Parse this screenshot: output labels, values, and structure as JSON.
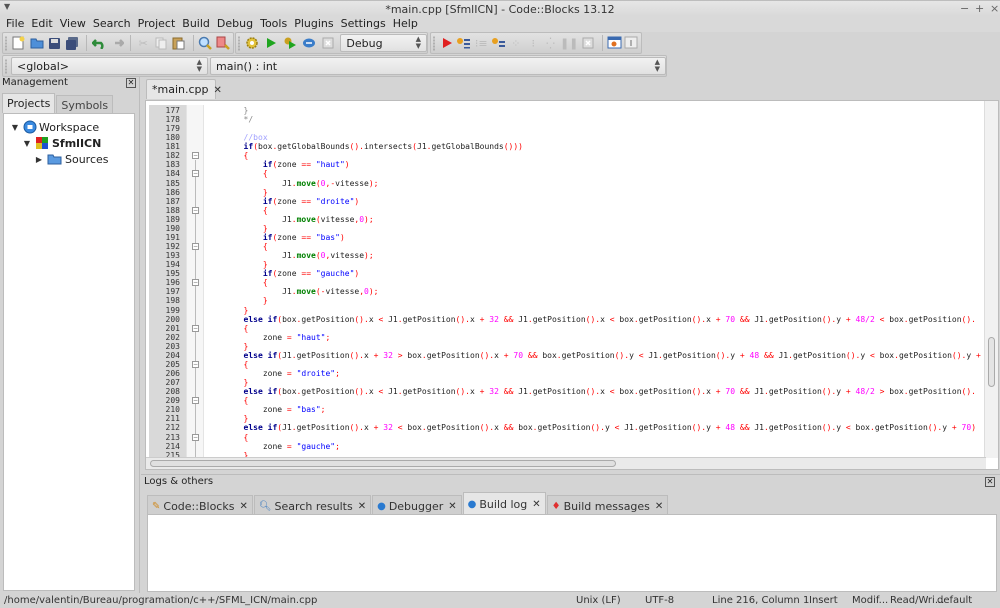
{
  "window": {
    "title": "*main.cpp [SfmlICN] - Code::Blocks 13.12",
    "controls": [
      "−",
      "+",
      "×"
    ]
  },
  "menubar": [
    "File",
    "Edit",
    "View",
    "Search",
    "Project",
    "Build",
    "Debug",
    "Tools",
    "Plugins",
    "Settings",
    "Help"
  ],
  "toolbar": {
    "build_target": "Debug",
    "scope_combo": "<global>",
    "function_combo": "main() : int"
  },
  "management": {
    "title": "Management",
    "tabs": [
      "Projects",
      "Symbols"
    ],
    "active_tab": "Projects",
    "tree": {
      "workspace": "Workspace",
      "project": "SfmlICN",
      "folder": "Sources"
    }
  },
  "editor": {
    "tab_label": "*main.cpp",
    "lines": [
      {
        "n": "177",
        "html": "<span class=\"cm2\">}</span>",
        "indent": 8
      },
      {
        "n": "178",
        "html": "<span class=\"cm2\">*/</span>",
        "indent": 8
      },
      {
        "n": "179",
        "html": "",
        "indent": 8
      },
      {
        "n": "180",
        "html": "<span class=\"cmt\">//box</span>",
        "indent": 8
      },
      {
        "n": "181",
        "html": "<span class=\"kw\">if</span><span class=\"op\">(</span>box<span class=\"op\">.</span>getGlobalBounds<span class=\"op\">().</span>intersects<span class=\"op\">(</span>J1<span class=\"op\">.</span>getGlobalBounds<span class=\"op\">()))</span>",
        "indent": 8
      },
      {
        "n": "182",
        "html": "<span class=\"op\">{</span>",
        "indent": 8
      },
      {
        "n": "183",
        "html": "<span class=\"kw\">if</span><span class=\"op\">(</span>zone <span class=\"op\">==</span> <span class=\"str\">\"haut\"</span><span class=\"op\">)</span>",
        "indent": 12
      },
      {
        "n": "184",
        "html": "<span class=\"op\">{</span>",
        "indent": 12
      },
      {
        "n": "185",
        "html": "J1<span class=\"op\">.</span><span class=\"fn\">move</span><span class=\"op\">(</span><span class=\"num\">0</span><span class=\"op\">,-</span>vitesse<span class=\"op\">);</span>",
        "indent": 16
      },
      {
        "n": "186",
        "html": "<span class=\"op\">}</span>",
        "indent": 12
      },
      {
        "n": "187",
        "html": "<span class=\"kw\">if</span><span class=\"op\">(</span>zone <span class=\"op\">==</span> <span class=\"str\">\"droite\"</span><span class=\"op\">)</span>",
        "indent": 12
      },
      {
        "n": "188",
        "html": "<span class=\"op\">{</span>",
        "indent": 12
      },
      {
        "n": "189",
        "html": "J1<span class=\"op\">.</span><span class=\"fn\">move</span><span class=\"op\">(</span>vitesse<span class=\"op\">,</span><span class=\"num\">0</span><span class=\"op\">);</span>",
        "indent": 16
      },
      {
        "n": "190",
        "html": "<span class=\"op\">}</span>",
        "indent": 12
      },
      {
        "n": "191",
        "html": "<span class=\"kw\">if</span><span class=\"op\">(</span>zone <span class=\"op\">==</span> <span class=\"str\">\"bas\"</span><span class=\"op\">)</span>",
        "indent": 12
      },
      {
        "n": "192",
        "html": "<span class=\"op\">{</span>",
        "indent": 12
      },
      {
        "n": "193",
        "html": "J1<span class=\"op\">.</span><span class=\"fn\">move</span><span class=\"op\">(</span><span class=\"num\">0</span><span class=\"op\">,</span>vitesse<span class=\"op\">);</span>",
        "indent": 16
      },
      {
        "n": "194",
        "html": "<span class=\"op\">}</span>",
        "indent": 12
      },
      {
        "n": "195",
        "html": "<span class=\"kw\">if</span><span class=\"op\">(</span>zone <span class=\"op\">==</span> <span class=\"str\">\"gauche\"</span><span class=\"op\">)</span>",
        "indent": 12
      },
      {
        "n": "196",
        "html": "<span class=\"op\">{</span>",
        "indent": 12
      },
      {
        "n": "197",
        "html": "J1<span class=\"op\">.</span><span class=\"fn\">move</span><span class=\"op\">(-</span>vitesse<span class=\"op\">,</span><span class=\"num\">0</span><span class=\"op\">);</span>",
        "indent": 16
      },
      {
        "n": "198",
        "html": "<span class=\"op\">}</span>",
        "indent": 12
      },
      {
        "n": "199",
        "html": "<span class=\"op\">}</span>",
        "indent": 8
      },
      {
        "n": "200",
        "html": "<span class=\"kw\">else if</span><span class=\"op\">(</span>box<span class=\"op\">.</span>getPosition<span class=\"op\">().</span>x <span class=\"op\">&lt;</span> J1<span class=\"op\">.</span>getPosition<span class=\"op\">().</span>x <span class=\"op\">+</span> <span class=\"num\">32</span> <span class=\"op\">&amp;&amp;</span> J1<span class=\"op\">.</span>getPosition<span class=\"op\">().</span>x <span class=\"op\">&lt;</span> box<span class=\"op\">.</span>getPosition<span class=\"op\">().</span>x <span class=\"op\">+</span> <span class=\"num\">70</span> <span class=\"op\">&amp;&amp;</span> J1<span class=\"op\">.</span>getPosition<span class=\"op\">().</span>y <span class=\"op\">+</span> <span class=\"num\">48/2</span> <span class=\"op\">&lt;</span> box<span class=\"op\">.</span>getPosition<span class=\"op\">().</span>",
        "indent": 8
      },
      {
        "n": "201",
        "html": "<span class=\"op\">{</span>",
        "indent": 8
      },
      {
        "n": "202",
        "html": "zone <span class=\"op\">=</span> <span class=\"str\">\"haut\"</span><span class=\"op\">;</span>",
        "indent": 12
      },
      {
        "n": "203",
        "html": "<span class=\"op\">}</span>",
        "indent": 8
      },
      {
        "n": "204",
        "html": "<span class=\"kw\">else if</span><span class=\"op\">(</span>J1<span class=\"op\">.</span>getPosition<span class=\"op\">().</span>x <span class=\"op\">+</span> <span class=\"num\">32</span> <span class=\"op\">&gt;</span> box<span class=\"op\">.</span>getPosition<span class=\"op\">().</span>x <span class=\"op\">+</span> <span class=\"num\">70</span> <span class=\"op\">&amp;&amp;</span> box<span class=\"op\">.</span>getPosition<span class=\"op\">().</span>y <span class=\"op\">&lt;</span> J1<span class=\"op\">.</span>getPosition<span class=\"op\">().</span>y <span class=\"op\">+</span> <span class=\"num\">48</span> <span class=\"op\">&amp;&amp;</span> J1<span class=\"op\">.</span>getPosition<span class=\"op\">().</span>y <span class=\"op\">&lt;</span> box<span class=\"op\">.</span>getPosition<span class=\"op\">().</span>y <span class=\"op\">+</span>",
        "indent": 8
      },
      {
        "n": "205",
        "html": "<span class=\"op\">{</span>",
        "indent": 8
      },
      {
        "n": "206",
        "html": "zone <span class=\"op\">=</span> <span class=\"str\">\"droite\"</span><span class=\"op\">;</span>",
        "indent": 12
      },
      {
        "n": "207",
        "html": "<span class=\"op\">}</span>",
        "indent": 8
      },
      {
        "n": "208",
        "html": "<span class=\"kw\">else if</span><span class=\"op\">(</span>box<span class=\"op\">.</span>getPosition<span class=\"op\">().</span>x <span class=\"op\">&lt;</span> J1<span class=\"op\">.</span>getPosition<span class=\"op\">().</span>x <span class=\"op\">+</span> <span class=\"num\">32</span> <span class=\"op\">&amp;&amp;</span> J1<span class=\"op\">.</span>getPosition<span class=\"op\">().</span>x <span class=\"op\">&lt;</span> box<span class=\"op\">.</span>getPosition<span class=\"op\">().</span>x <span class=\"op\">+</span> <span class=\"num\">70</span> <span class=\"op\">&amp;&amp;</span> J1<span class=\"op\">.</span>getPosition<span class=\"op\">().</span>y <span class=\"op\">+</span> <span class=\"num\">48/2</span> <span class=\"op\">&gt;</span> box<span class=\"op\">.</span>getPosition<span class=\"op\">().</span>",
        "indent": 8
      },
      {
        "n": "209",
        "html": "<span class=\"op\">{</span>",
        "indent": 8
      },
      {
        "n": "210",
        "html": "zone <span class=\"op\">=</span> <span class=\"str\">\"bas\"</span><span class=\"op\">;</span>",
        "indent": 12
      },
      {
        "n": "211",
        "html": "<span class=\"op\">}</span>",
        "indent": 8
      },
      {
        "n": "212",
        "html": "<span class=\"kw\">else if</span><span class=\"op\">(</span>J1<span class=\"op\">.</span>getPosition<span class=\"op\">().</span>x <span class=\"op\">+</span> <span class=\"num\">32</span> <span class=\"op\">&lt;</span> box<span class=\"op\">.</span>getPosition<span class=\"op\">().</span>x <span class=\"op\">&amp;&amp;</span> box<span class=\"op\">.</span>getPosition<span class=\"op\">().</span>y <span class=\"op\">&lt;</span> J1<span class=\"op\">.</span>getPosition<span class=\"op\">().</span>y <span class=\"op\">+</span> <span class=\"num\">48</span> <span class=\"op\">&amp;&amp;</span> J1<span class=\"op\">.</span>getPosition<span class=\"op\">().</span>y <span class=\"op\">&lt;</span> box<span class=\"op\">.</span>getPosition<span class=\"op\">().</span>y <span class=\"op\">+</span> <span class=\"num\">70</span><span class=\"op\">)</span>",
        "indent": 8
      },
      {
        "n": "213",
        "html": "<span class=\"op\">{</span>",
        "indent": 8
      },
      {
        "n": "214",
        "html": "zone <span class=\"op\">=</span> <span class=\"str\">\"gauche\"</span><span class=\"op\">;</span>",
        "indent": 12
      },
      {
        "n": "215",
        "html": "<span class=\"op\">}</span>",
        "indent": 8
      }
    ],
    "fold_lines": [
      "182",
      "184",
      "188",
      "192",
      "196",
      "201",
      "205",
      "209",
      "213"
    ]
  },
  "logs": {
    "title": "Logs & others",
    "tabs": [
      {
        "label": "Code::Blocks",
        "icon": "notepad-icon",
        "glyph": "📝"
      },
      {
        "label": "Search results",
        "icon": "magnifier-icon",
        "glyph": "🔍"
      },
      {
        "label": "Debugger",
        "icon": "debugger-icon",
        "glyph": "⬤"
      },
      {
        "label": "Build log",
        "icon": "build-log-icon",
        "glyph": "⬤"
      },
      {
        "label": "Build messages",
        "icon": "pin-icon",
        "glyph": "📌"
      }
    ],
    "active_tab": "Build log"
  },
  "statusbar": {
    "path": "/home/valentin/Bureau/programation/c++/SFML_ICN/main.cpp",
    "line_endings": "Unix (LF)",
    "encoding": "UTF-8",
    "position": "Line 216, Column 1",
    "mode": "Insert",
    "modified": "Modif...",
    "access": "Read/Wri...",
    "lexer": "default"
  },
  "colors": {
    "keyword": "#00008b",
    "string": "#0000ff",
    "number": "#ff00ff",
    "operator": "#ff0000",
    "function_call": "#008000",
    "comment": "#a0a0ff"
  }
}
